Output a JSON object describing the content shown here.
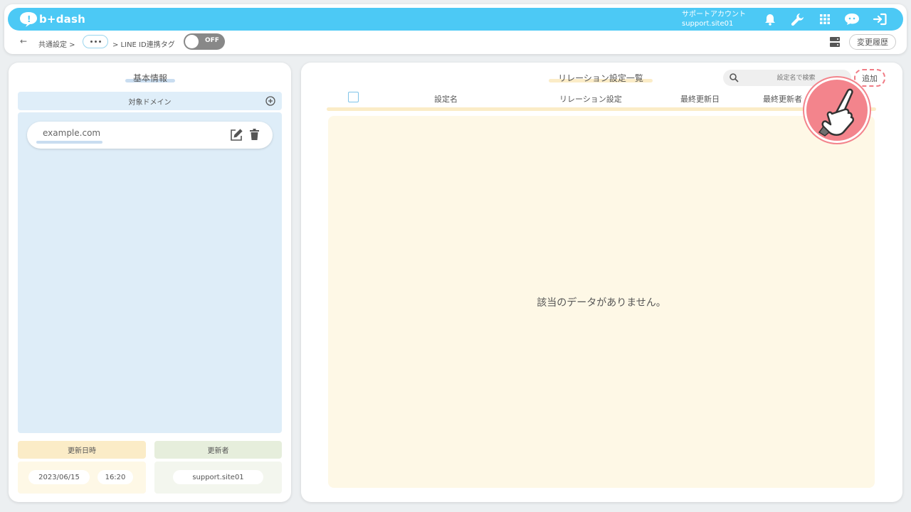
{
  "header": {
    "logo_text": "b+dash",
    "account_name": "サポートアカウント",
    "account_id": "support.site01"
  },
  "breadcrumb": {
    "back": "←",
    "item1": "共通設定 >",
    "item3": "> LINE ID連携タグ",
    "toggle_label": "OFF",
    "history_button": "変更履歴"
  },
  "left": {
    "title": "基本情報",
    "domain_header": "対象ドメイン",
    "domains": [
      "example.com"
    ],
    "updated_at_label": "更新日時",
    "updated_date": "2023/06/15",
    "updated_time": "16:20",
    "updater_label": "更新者",
    "updater": "support.site01"
  },
  "right": {
    "title": "リレーション設定一覧",
    "search_placeholder": "設定名で検索",
    "add_button": "追加",
    "columns": [
      "設定名",
      "リレーション設定",
      "最終更新日",
      "最終更新者"
    ],
    "empty_message": "該当のデータがありません。"
  },
  "colors": {
    "header": "#4cc9f5",
    "accent_red": "#f07b85",
    "table_bg": "#fef8e6",
    "domain_bg": "#deedf8"
  }
}
